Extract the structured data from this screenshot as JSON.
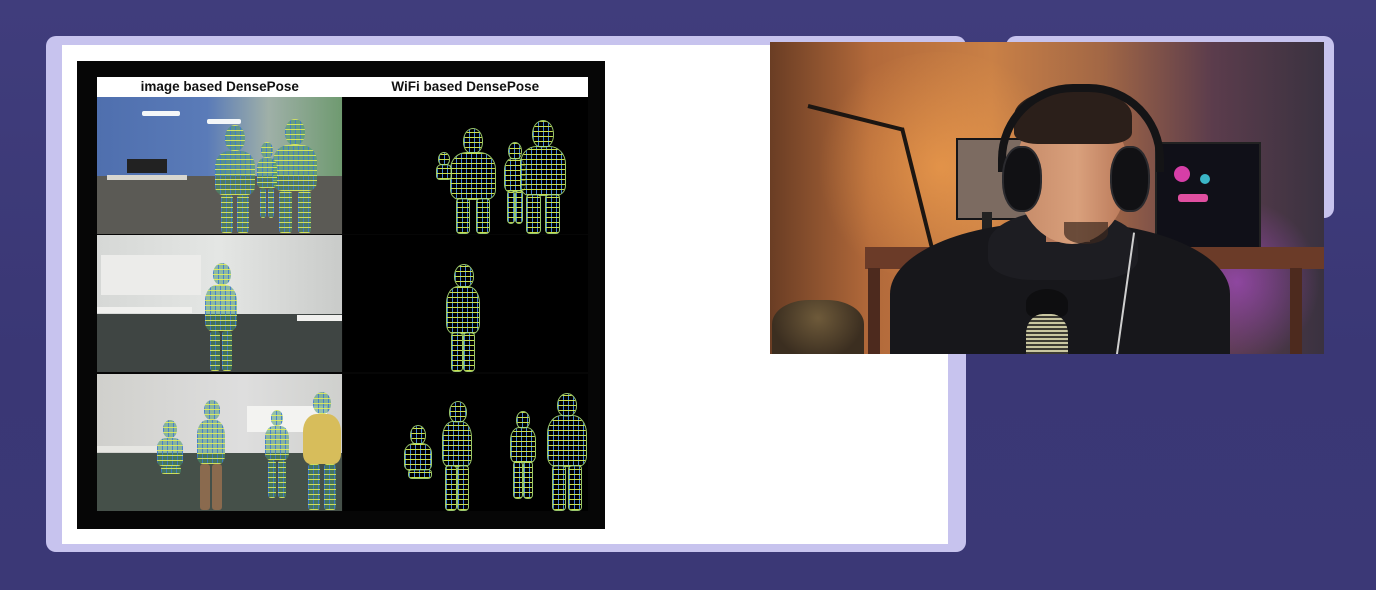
{
  "slide": {
    "figure": {
      "col_left_label": "image based DensePose",
      "col_right_label": "WiFi based DensePose"
    }
  },
  "colors": {
    "background": "#3d3a78",
    "frame": "#c7c3ee",
    "slide": "#ffffff",
    "figure_bg": "#060606",
    "mesh_yellow": "#d2eb50",
    "mesh_blue": "#468ce1"
  },
  "webcam": {
    "subject": "streamer with headphones and microphone"
  }
}
